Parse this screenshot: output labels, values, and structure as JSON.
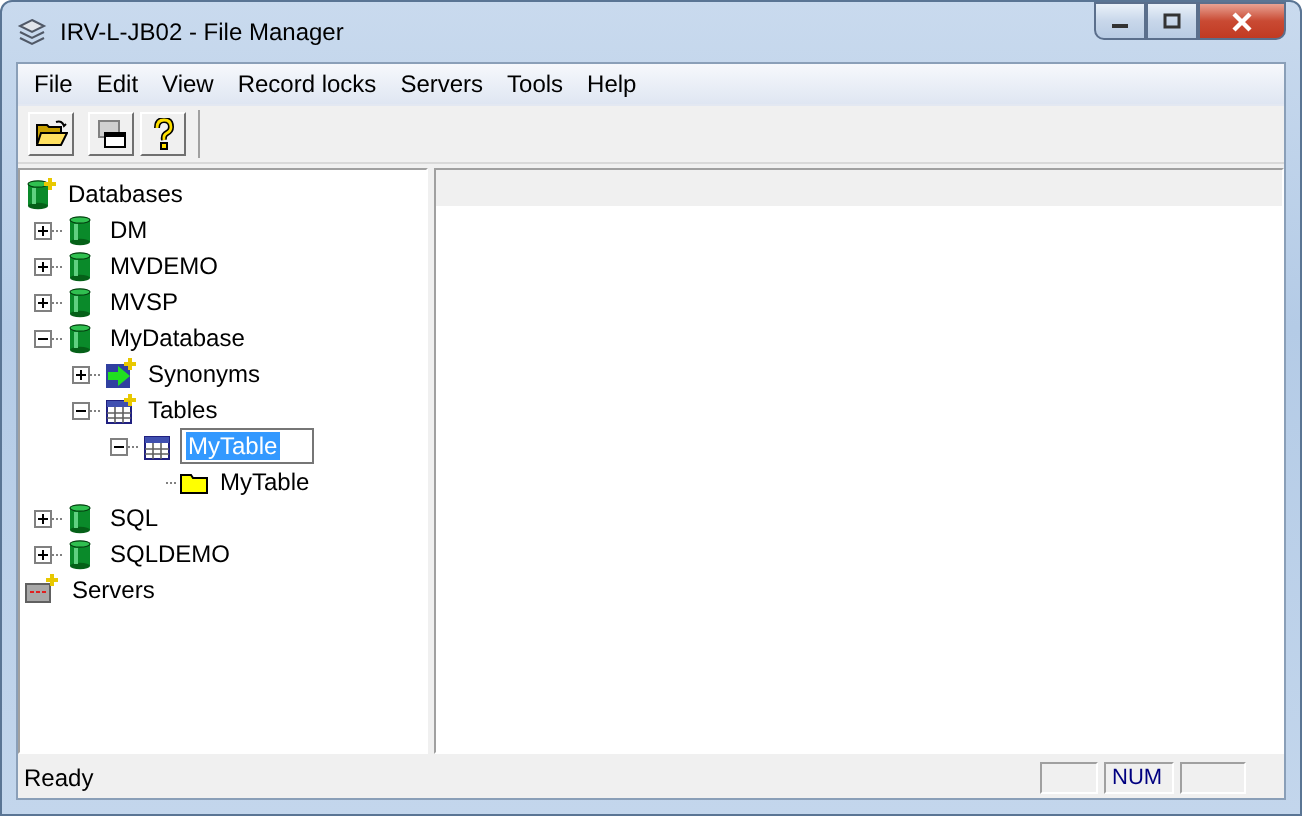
{
  "window": {
    "title": "IRV-L-JB02 - File Manager"
  },
  "menu": [
    "File",
    "Edit",
    "View",
    "Record locks",
    "Servers",
    "Tools",
    "Help"
  ],
  "toolbar": [
    {
      "kind": "open"
    },
    {
      "kind": "window"
    },
    {
      "kind": "help"
    }
  ],
  "tree": [
    {
      "label": "Databases",
      "kind": "db-root",
      "children": [
        {
          "label": "DM",
          "kind": "database",
          "expanded": false
        },
        {
          "label": "MVDEMO",
          "kind": "database",
          "expanded": false
        },
        {
          "label": "MVSP",
          "kind": "database",
          "expanded": false
        },
        {
          "label": "MyDatabase",
          "kind": "database",
          "expanded": true,
          "children": [
            {
              "label": "Synonyms",
              "kind": "synonyms",
              "expanded": false
            },
            {
              "label": "Tables",
              "kind": "tables",
              "expanded": true,
              "children": [
                {
                  "label": "MyTable",
                  "kind": "table",
                  "expanded": true,
                  "editing": true,
                  "children": [
                    {
                      "label": "MyTable",
                      "kind": "folder"
                    }
                  ]
                }
              ]
            }
          ]
        },
        {
          "label": "SQL",
          "kind": "database",
          "expanded": false
        },
        {
          "label": "SQLDEMO",
          "kind": "database",
          "expanded": false
        }
      ]
    },
    {
      "label": "Servers",
      "kind": "server-root"
    }
  ],
  "status_bar": {
    "text": "Ready",
    "indicators": [
      "NUM"
    ]
  }
}
